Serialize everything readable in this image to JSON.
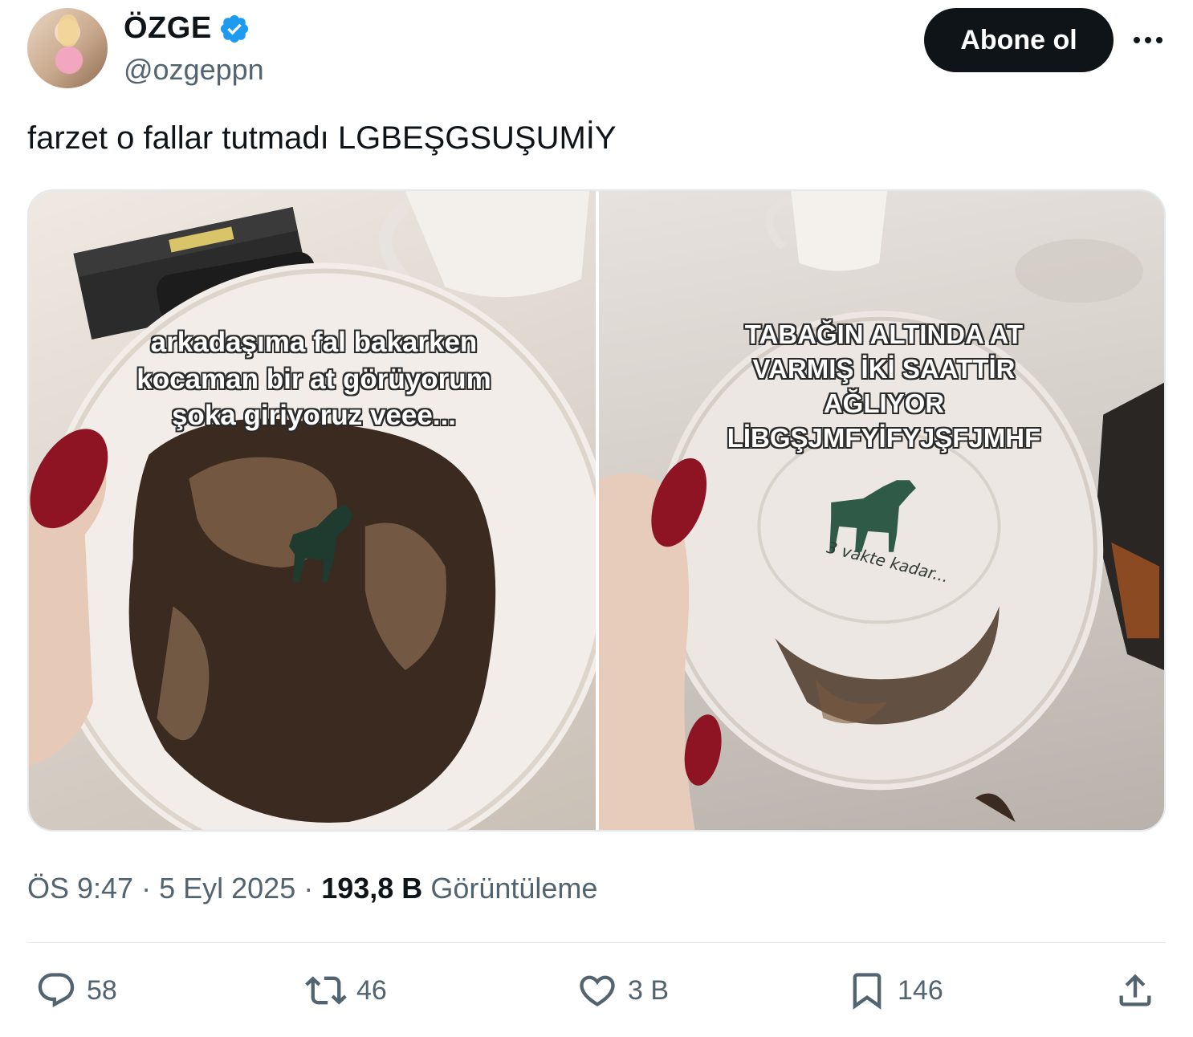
{
  "author": {
    "display_name": "ÖZGE",
    "handle": "@ozgeppn",
    "verified": true,
    "verified_color": "#1d9bf0"
  },
  "follow_button_label": "Abone ol",
  "more_icon": "more-horizontal-icon",
  "tweet_text": "farzet o fallar tutmadı LGBEŞGSUŞUMİY",
  "media": {
    "left_image": {
      "caption_lines": [
        "arkadaşıma fal bakarken",
        "kocaman bir at görüyorum",
        "şoka giriyoruz veee..."
      ]
    },
    "right_image": {
      "caption_lines": [
        "TABAĞIN ALTINDA AT",
        "VARMIŞ İKİ SAATTİR",
        "AĞLIYOR",
        "LİBGŞJMFYİFYJŞFJMHF"
      ],
      "saucer_print": "3 vakte kadar..."
    }
  },
  "meta": {
    "time": "ÖS 9:47",
    "separator": "·",
    "date": "5 Eyl 2025",
    "views_count": "193,8 B",
    "views_label": "Görüntüleme"
  },
  "actions": {
    "reply_count": "58",
    "retweet_count": "46",
    "like_count": "3 B",
    "bookmark_count": "146"
  }
}
